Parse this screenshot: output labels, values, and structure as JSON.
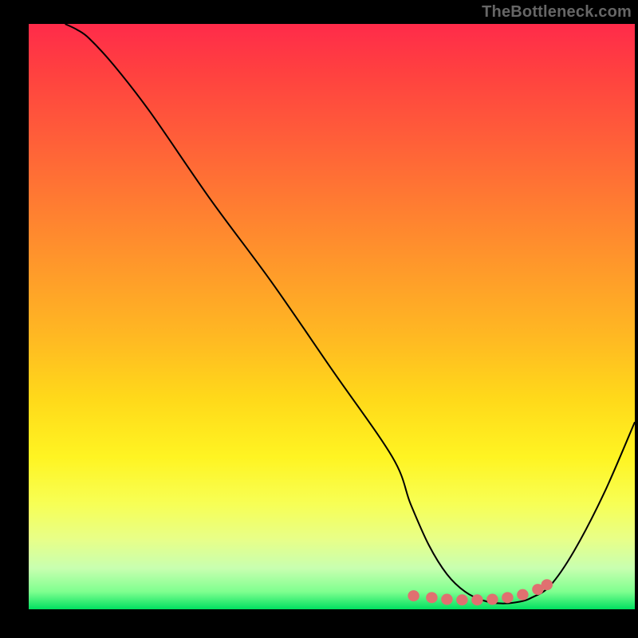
{
  "watermark": "TheBottleneck.com",
  "chart_data": {
    "type": "line",
    "title": "",
    "xlabel": "",
    "ylabel": "",
    "xlim": [
      0,
      100
    ],
    "ylim": [
      0,
      100
    ],
    "grid": false,
    "legend": false,
    "series": [
      {
        "name": "bottleneck-curve",
        "color": "#000000",
        "x": [
          6,
          8,
          10,
          14,
          20,
          30,
          40,
          50,
          60,
          63,
          66,
          69,
          72,
          75,
          78,
          81,
          83,
          86,
          90,
          95,
          100
        ],
        "y": [
          100,
          99,
          97.5,
          93,
          85,
          70,
          56,
          41,
          26,
          18,
          11,
          6,
          3,
          1.5,
          1,
          1.3,
          2,
          4,
          10,
          20,
          32
        ]
      }
    ],
    "markers": [
      {
        "name": "baseline-dot",
        "shape": "round",
        "color": "#e07070",
        "x": 63.5,
        "y": 2.3
      },
      {
        "name": "baseline-dot",
        "shape": "round",
        "color": "#e07070",
        "x": 66.5,
        "y": 2.0
      },
      {
        "name": "baseline-dot",
        "shape": "round",
        "color": "#e07070",
        "x": 69.0,
        "y": 1.7
      },
      {
        "name": "baseline-dot",
        "shape": "round",
        "color": "#e07070",
        "x": 71.5,
        "y": 1.6
      },
      {
        "name": "baseline-dot",
        "shape": "round",
        "color": "#e07070",
        "x": 74.0,
        "y": 1.6
      },
      {
        "name": "baseline-dot",
        "shape": "round",
        "color": "#e07070",
        "x": 76.5,
        "y": 1.7
      },
      {
        "name": "baseline-dot",
        "shape": "round",
        "color": "#e07070",
        "x": 79.0,
        "y": 2.0
      },
      {
        "name": "baseline-dot",
        "shape": "round",
        "color": "#e07070",
        "x": 81.5,
        "y": 2.5
      },
      {
        "name": "baseline-dot",
        "shape": "round",
        "color": "#e07070",
        "x": 84.0,
        "y": 3.4
      },
      {
        "name": "baseline-dot",
        "shape": "round",
        "color": "#e07070",
        "x": 85.5,
        "y": 4.2
      }
    ]
  }
}
